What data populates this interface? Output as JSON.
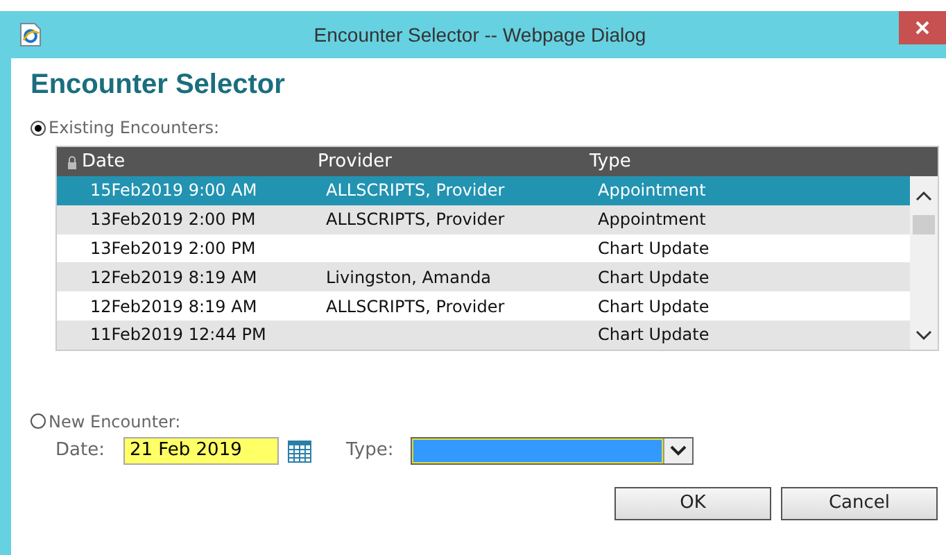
{
  "window": {
    "title": "Encounter Selector -- Webpage Dialog"
  },
  "heading": "Encounter Selector",
  "existing": {
    "label": "Existing Encounters:",
    "selected": true
  },
  "table": {
    "columns": [
      "Date",
      "Provider",
      "Type"
    ],
    "rows": [
      {
        "cells": [
          "15Feb2019 9:00 AM",
          "ALLSCRIPTS, Provider",
          "Appointment"
        ],
        "selected": true
      },
      {
        "cells": [
          "13Feb2019 2:00 PM",
          "ALLSCRIPTS, Provider",
          "Appointment"
        ],
        "selected": false
      },
      {
        "cells": [
          "13Feb2019 2:00 PM",
          "",
          "Chart Update"
        ],
        "selected": false
      },
      {
        "cells": [
          "12Feb2019 8:19 AM",
          "Livingston, Amanda",
          "Chart Update"
        ],
        "selected": false
      },
      {
        "cells": [
          "12Feb2019 8:19 AM",
          "ALLSCRIPTS, Provider",
          "Chart Update"
        ],
        "selected": false
      },
      {
        "cells": [
          "11Feb2019 12:44 PM",
          "",
          "Chart Update"
        ],
        "selected": false
      }
    ]
  },
  "new_encounter": {
    "label": "New Encounter:",
    "selected": false,
    "date_label": "Date:",
    "date_value": "21 Feb 2019",
    "type_label": "Type:"
  },
  "buttons": [
    "OK",
    "Cancel"
  ]
}
